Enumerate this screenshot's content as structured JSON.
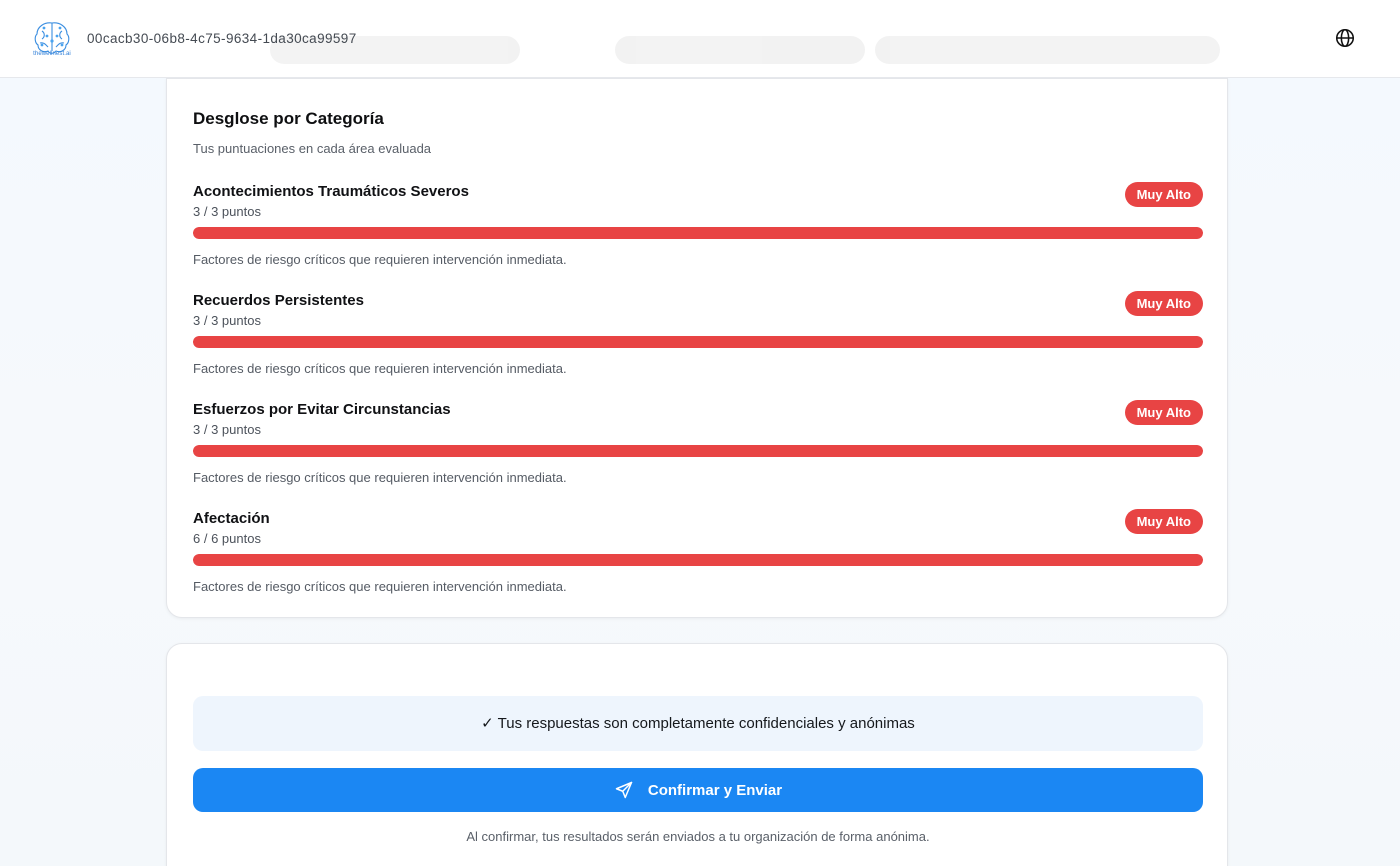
{
  "header": {
    "logo_text": "thewellnest.ai",
    "session_id": "00cacb30-06b8-4c75-9634-1da30ca99597",
    "language_icon": "globe-icon"
  },
  "breakdown": {
    "title": "Desglose por Categoría",
    "subtitle": "Tus puntuaciones en cada área evaluada",
    "categories": [
      {
        "name": "Acontecimientos Traumáticos Severos",
        "score": "3 / 3 puntos",
        "level": "Muy Alto",
        "progress": 1.0,
        "description": "Factores de riesgo críticos que requieren intervención inmediata."
      },
      {
        "name": "Recuerdos Persistentes",
        "score": "3 / 3 puntos",
        "level": "Muy Alto",
        "progress": 1.0,
        "description": "Factores de riesgo críticos que requieren intervención inmediata."
      },
      {
        "name": "Esfuerzos por Evitar Circunstancias",
        "score": "3 / 3 puntos",
        "level": "Muy Alto",
        "progress": 1.0,
        "description": "Factores de riesgo críticos que requieren intervención inmediata."
      },
      {
        "name": "Afectación",
        "score": "6 / 6 puntos",
        "level": "Muy Alto",
        "progress": 1.0,
        "description": "Factores de riesgo críticos que requieren intervención inmediata."
      }
    ]
  },
  "confirm": {
    "notice": "✓ Tus respuestas son completamente confidenciales y anónimas",
    "submit_label": "Confirmar y Enviar",
    "submit_icon": "send-icon",
    "footnote": "Al confirmar, tus resultados serán enviados a tu organización de forma anónima."
  },
  "colors": {
    "accent": "#1b87f3",
    "risk_very_high": "#e84444",
    "notice_bg": "#eef5fd"
  }
}
